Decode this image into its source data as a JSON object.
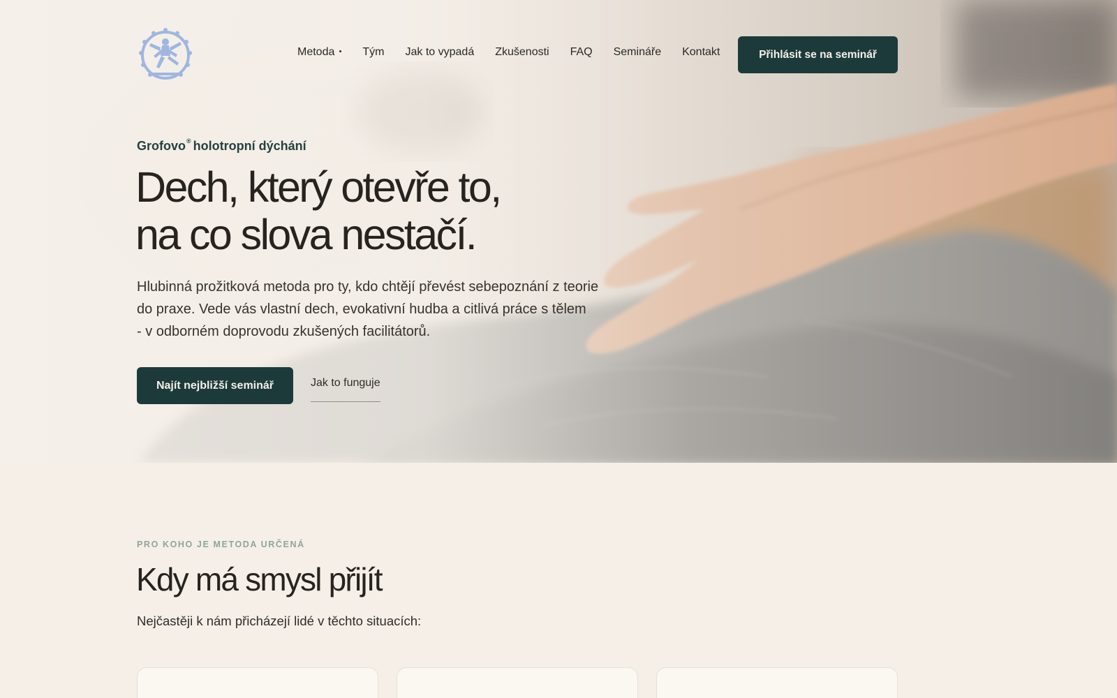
{
  "colors": {
    "accent_dark": "#1d3a3a",
    "page_background": "#f5efe8",
    "logo_blue": "#9fb6e0",
    "eyebrow_green": "#8fa59d"
  },
  "header": {
    "logo_icon": "dancing-shiva-logo",
    "nav": [
      {
        "label": "Metoda",
        "has_submenu": true
      },
      {
        "label": "Tým"
      },
      {
        "label": "Jak to vypadá"
      },
      {
        "label": "Zkušenosti"
      },
      {
        "label": "FAQ"
      },
      {
        "label": "Semináře"
      },
      {
        "label": "Kontakt"
      }
    ],
    "cta_label": "Přihlásit se na seminář"
  },
  "hero": {
    "eyebrow_brand": "Grofovo",
    "eyebrow_mark": "®",
    "eyebrow_rest": "holotropní dýchání",
    "title_lines": [
      "Dech, který otevře to,",
      "na co slova nestačí."
    ],
    "lead_lines": [
      "Hlubinná prožitková metoda pro ty, kdo chtějí převést sebepoznání z teorie",
      "do praxe. Vede vás vlastní dech, evokativní hudba a citlivá práce s tělem",
      "- v odborném doprovodu zkušených facilitátorů."
    ],
    "primary_button": "Najít nejbližší seminář",
    "secondary_link": "Jak to funguje"
  },
  "audience_section": {
    "eyebrow": "PRO KOHO JE METODA URČENÁ",
    "title": "Kdy má smysl přijít",
    "subtitle": "Nejčastěji k nám přicházejí lidé v těchto situacích:",
    "cards": [
      {},
      {},
      {}
    ]
  }
}
